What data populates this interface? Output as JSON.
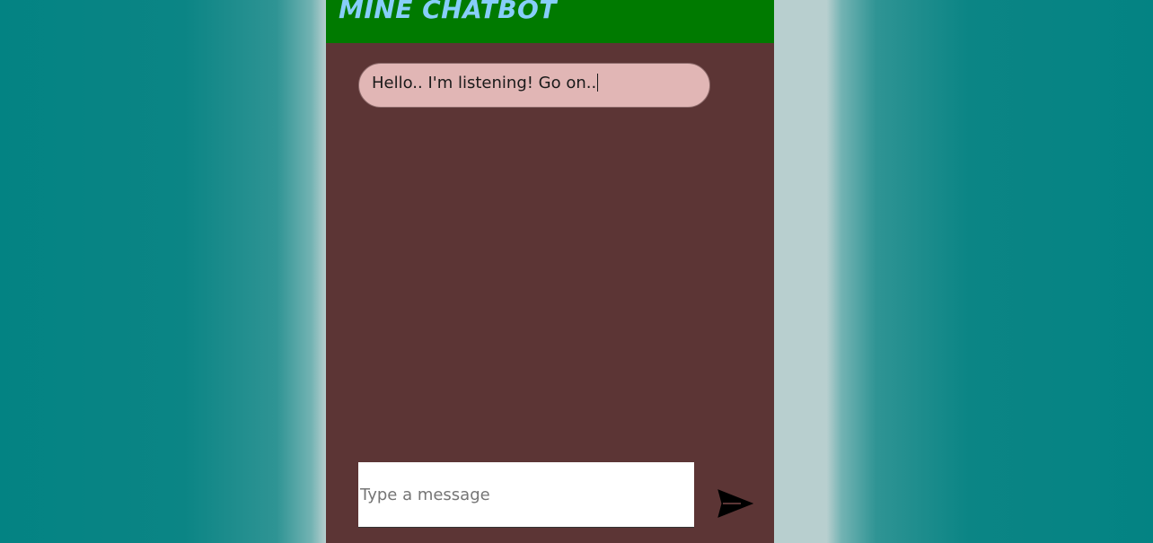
{
  "header": {
    "title": "MINE CHATBOT"
  },
  "messages": [
    {
      "sender": "bot",
      "text": "Hello.. I'm listening! Go on.."
    }
  ],
  "composer": {
    "placeholder": "Type a message",
    "value": ""
  },
  "icons": {
    "send": "send-arrow-icon"
  },
  "colors": {
    "page_background": "#038383",
    "page_center_glow": "#b8cfcf",
    "chat_background": "#5c3535",
    "header_background": "#007a00",
    "title_color": "#87cefa",
    "bubble_background": "#e1b6b5",
    "input_background": "#ffffff",
    "send_icon": "#000000"
  }
}
